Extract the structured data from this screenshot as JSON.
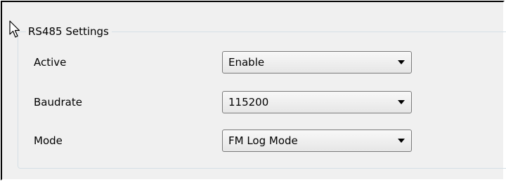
{
  "group": {
    "title": "RS485 Settings"
  },
  "fields": [
    {
      "label": "Active",
      "value": "Enable"
    },
    {
      "label": "Baudrate",
      "value": "115200"
    },
    {
      "label": "Mode",
      "value": "FM Log Mode"
    }
  ],
  "icons": {
    "cursor": "mouse-pointer-icon",
    "dropdown": "chevron-down-icon"
  },
  "colors": {
    "panel_background": "#f0f0f0",
    "group_border": "#d5dfe5",
    "combo_border": "#7a7a7a"
  }
}
